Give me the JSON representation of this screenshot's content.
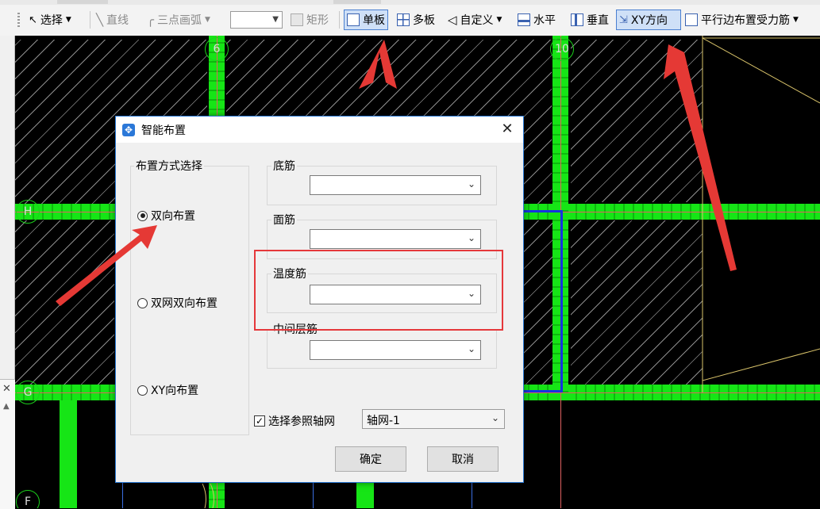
{
  "toolbar": {
    "select_label": "选择",
    "line_label": "直线",
    "arc_label": "三点画弧",
    "rect_label": "矩形",
    "single_slab_label": "单板",
    "multi_slab_label": "多板",
    "custom_label": "自定义",
    "horizontal_label": "水平",
    "vertical_label": "垂直",
    "xy_label": "XY方向",
    "parallel_label": "平行边布置受力筋"
  },
  "grid_axes": {
    "top_a": "6",
    "top_b": "10",
    "row_a": "H",
    "row_b": "G",
    "row_c": "F"
  },
  "dialog": {
    "title": "智能布置",
    "method_group_label": "布置方式选择",
    "option_bidirectional": "双向布置",
    "option_double_mesh": "双网双向布置",
    "option_xy": "XY向布置",
    "bottom_rebar_label": "底筋",
    "top_rebar_label": "面筋",
    "temp_rebar_label": "温度筋",
    "middle_rebar_label": "中间层筋",
    "ref_grid_checkbox_label": "选择参照轴网",
    "ref_grid_value": "轴网-1",
    "ok_label": "确定",
    "cancel_label": "取消"
  },
  "colors": {
    "beam": "#16e516",
    "highlight": "#e5383b",
    "selection_frame": "#1733e0"
  }
}
